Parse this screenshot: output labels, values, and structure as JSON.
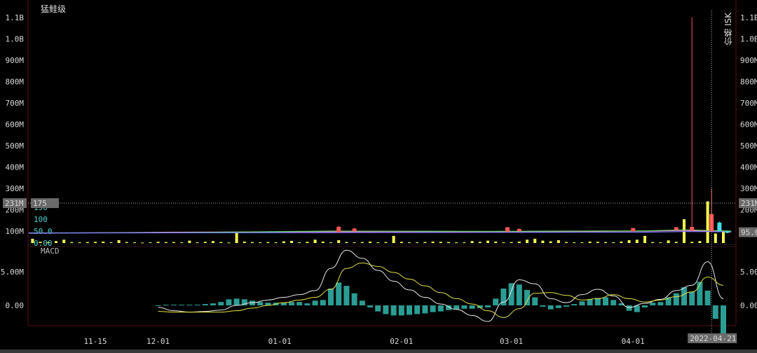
{
  "header": {
    "title": "猛鲑级",
    "price_axis_label": "价格 ISK"
  },
  "macd_label": "MACD",
  "colors": {
    "volume": "#ffff4d",
    "up": "#ff5555",
    "down": "#40e0e0",
    "dif": "#e8e8e8",
    "dea": "#e0e040",
    "hist": "#2a9d94",
    "axis": "#5a1010"
  },
  "crosshair": {
    "date": "2022-04-21",
    "price_label": "231M",
    "volume_label": "175",
    "last_price_label": "95.0M"
  },
  "chart_data": {
    "type": "candlestick+volume+macd",
    "x_ticks": [
      {
        "label": "11-15",
        "day": 0
      },
      {
        "label": "12-01",
        "day": 16
      },
      {
        "label": "01-01",
        "day": 47
      },
      {
        "label": "02-01",
        "day": 78
      },
      {
        "label": "03-01",
        "day": 106
      },
      {
        "label": "04-01",
        "day": 137
      }
    ],
    "price_ticks": [
      "100M",
      "200M",
      "300M",
      "400M",
      "500M",
      "600M",
      "700M",
      "800M",
      "900M",
      "1.0B",
      "1.1B"
    ],
    "price_tick_values": [
      100,
      200,
      300,
      400,
      500,
      600,
      700,
      800,
      900,
      1000,
      1100
    ],
    "volume_ticks": [
      "0.00",
      "50.0",
      "100",
      "150"
    ],
    "volume_tick_values": [
      0,
      50,
      100,
      150
    ],
    "macd_ticks": [
      "0.00",
      "5.00M"
    ],
    "macd_tick_values": [
      0,
      5
    ],
    "volume": {
      "start_day": -16,
      "step": 2,
      "values": [
        18,
        5,
        3,
        8,
        14,
        4,
        3,
        4,
        5,
        6,
        3,
        12,
        4,
        3,
        2,
        3,
        5,
        4,
        4,
        3,
        10,
        3,
        5,
        8,
        4,
        2,
        48,
        6,
        4,
        3,
        4,
        3,
        7,
        9,
        3,
        5,
        14,
        6,
        3,
        12,
        4,
        3,
        4,
        6,
        3,
        4,
        30,
        5,
        3,
        3,
        4,
        6,
        5,
        4,
        3,
        3,
        8,
        5,
        10,
        6,
        3,
        4,
        6,
        14,
        18,
        10,
        7,
        12,
        4,
        3,
        3,
        6,
        5,
        4,
        3,
        6,
        12,
        14,
        30,
        4,
        3,
        11,
        5,
        100,
        5,
        8,
        175,
        40,
        50
      ]
    },
    "moving_averages": [
      {
        "name": "ma1",
        "color": "#ff66cc",
        "days": [
          -17,
          20,
          60,
          100,
          140,
          150,
          162
        ],
        "values": [
          90,
          95,
          97,
          96,
          100,
          103,
          96
        ]
      },
      {
        "name": "ma2",
        "color": "#66dd66",
        "days": [
          -17,
          20,
          60,
          100,
          140,
          150,
          162
        ],
        "values": [
          92,
          93,
          100,
          99,
          101,
          106,
          100
        ]
      },
      {
        "name": "ma3",
        "color": "#7777ff",
        "days": [
          -17,
          20,
          60,
          100,
          140,
          150,
          162
        ],
        "values": [
          91,
          92,
          93,
          94,
          95,
          98,
          97
        ]
      }
    ],
    "candles": [
      {
        "day": 62,
        "open": 95,
        "close": 120,
        "high": 125,
        "low": 94
      },
      {
        "day": 66,
        "open": 100,
        "close": 112,
        "high": 116,
        "low": 98
      },
      {
        "day": 105,
        "open": 98,
        "close": 118,
        "high": 120,
        "low": 96
      },
      {
        "day": 108,
        "open": 100,
        "close": 110,
        "high": 114,
        "low": 98
      },
      {
        "day": 137,
        "open": 100,
        "close": 114,
        "high": 116,
        "low": 99
      },
      {
        "day": 148,
        "open": 106,
        "close": 118,
        "high": 120,
        "low": 104
      },
      {
        "day": 152,
        "open": 104,
        "close": 120,
        "high": 1100,
        "low": 100
      },
      {
        "day": 157,
        "open": 100,
        "close": 180,
        "high": 300,
        "low": 95
      },
      {
        "day": 159,
        "open": 140,
        "close": 100,
        "high": 145,
        "low": 98
      },
      {
        "day": 161,
        "open": 100,
        "close": 92,
        "high": 102,
        "low": 90
      }
    ],
    "macd": {
      "line_start_day": 16,
      "line_step": 4,
      "dif": [
        -0.3,
        -0.8,
        -1,
        -0.9,
        -0.7,
        0,
        0.4,
        0.8,
        1.2,
        1.6,
        2.2,
        5.5,
        8.2,
        7.0,
        5.2,
        3.6,
        2.3,
        1.2,
        0.2,
        -0.6,
        -1.5,
        -2.4,
        0.5,
        3.8,
        3.2,
        1.0,
        0.4,
        1.6,
        2.4,
        1.4,
        -0.3,
        0.3,
        0.9,
        2.2,
        3.0,
        6.5,
        1.0
      ],
      "dea": [
        -0.9,
        -1,
        -1,
        -1,
        -1,
        -0.8,
        -0.4,
        0,
        0.4,
        0.8,
        1.2,
        2.4,
        5.5,
        6.3,
        5.8,
        4.9,
        3.9,
        2.9,
        1.9,
        1.0,
        0.2,
        -0.8,
        -1.8,
        -0.5,
        1.8,
        1.9,
        1.5,
        0.8,
        1.0,
        1.6,
        1.0,
        0.5,
        0.8,
        1.3,
        2.0,
        4.2,
        3.0
      ],
      "hist_start_day": 16,
      "hist_step": 2,
      "hist": [
        -0.1,
        0.1,
        0.1,
        0.1,
        0.1,
        0.1,
        0.2,
        0.3,
        0.5,
        0.9,
        1,
        0.9,
        0.7,
        0.5,
        0.4,
        0.4,
        0.4,
        0.5,
        0.5,
        0.3,
        0.7,
        0.8,
        2.5,
        3.4,
        2.9,
        1.8,
        0.7,
        -0.3,
        -0.9,
        -1.3,
        -1.5,
        -1.5,
        -1.4,
        -1.3,
        -1.2,
        -1.0,
        -0.9,
        -0.7,
        -0.6,
        -0.5,
        -0.5,
        -0.4,
        -0.3,
        1,
        2.5,
        3.3,
        3.1,
        2.3,
        1.2,
        -0.2,
        -0.6,
        -0.4,
        -0.2,
        0.2,
        0.6,
        0.9,
        1.1,
        1.2,
        0.8,
        0.3,
        -0.8,
        -1.0,
        -0.3,
        0.4,
        0.5,
        1.2,
        1.8,
        2.7,
        2,
        3.5,
        2.2,
        -2,
        -5.5
      ]
    },
    "crosshair_day": 157,
    "crosshair_price": 231,
    "last_price": 95
  }
}
